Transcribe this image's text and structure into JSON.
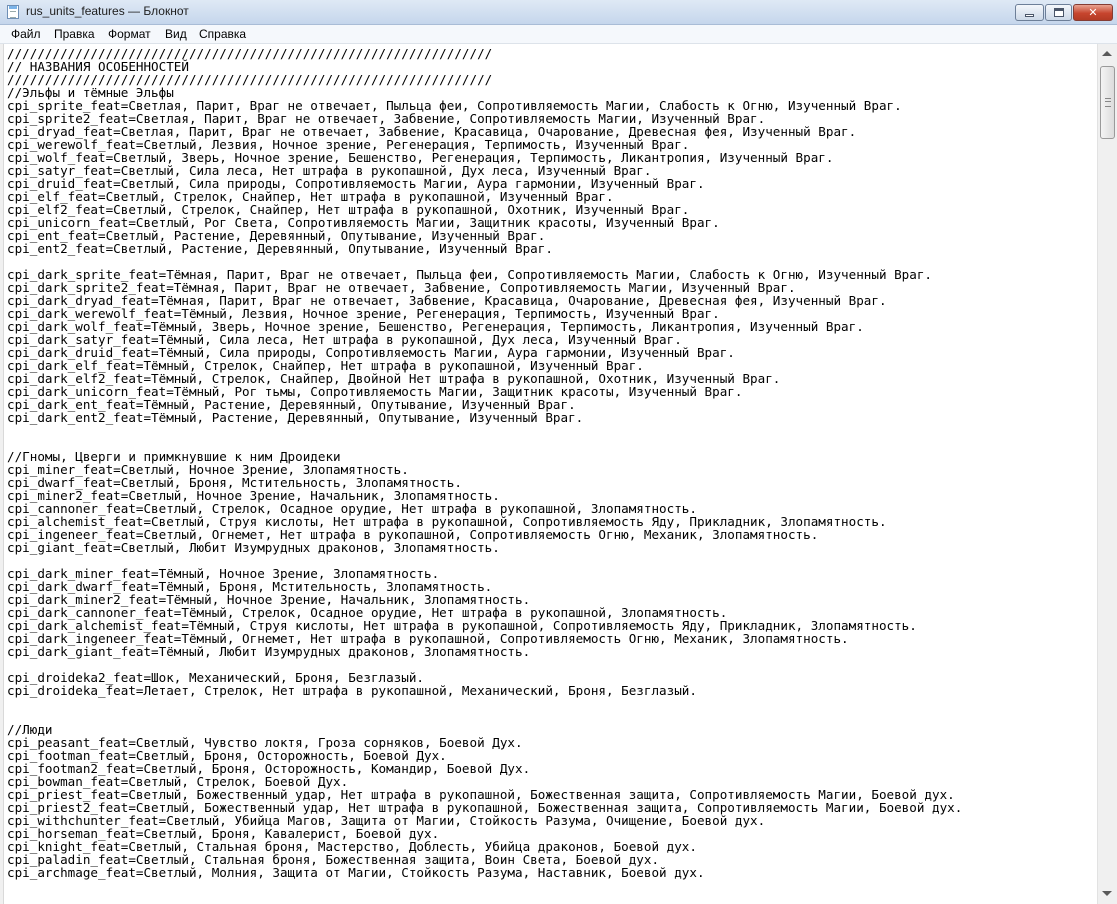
{
  "window": {
    "title": "rus_units_features — Блокнот",
    "buttons": {
      "close_glyph": "✕"
    }
  },
  "menubar": {
    "file": "Файл",
    "edit": "Правка",
    "format": "Формат",
    "view": "Вид",
    "help": "Справка"
  },
  "editor": {
    "lines": [
      "////////////////////////////////////////////////////////////////",
      "// НАЗВАНИЯ ОСОБЕННОСТЕЙ",
      "////////////////////////////////////////////////////////////////",
      "//Эльфы и тёмные Эльфы",
      "cpi_sprite_feat=Светлая, Парит, Враг не отвечает, Пыльца феи, Сопротивляемость Магии, Слабость к Огню, Изученный Враг.",
      "cpi_sprite2_feat=Светлая, Парит, Враг не отвечает, Забвение, Сопротивляемость Магии, Изученный Враг.",
      "cpi_dryad_feat=Светлая, Парит, Враг не отвечает, Забвение, Красавица, Очарование, Древесная фея, Изученный Враг.",
      "cpi_werewolf_feat=Светлый, Лезвия, Ночное зрение, Регенерация, Терпимость, Изученный Враг.",
      "cpi_wolf_feat=Светлый, Зверь, Ночное зрение, Бешенство, Регенерация, Терпимость, Ликантропия, Изученный Враг.",
      "cpi_satyr_feat=Светлый, Сила леса, Нет штрафа в рукопашной, Дух леса, Изученный Враг.",
      "cpi_druid_feat=Светлый, Сила природы, Сопротивляемость Магии, Аура гармонии, Изученный Враг.",
      "cpi_elf_feat=Светлый, Стрелок, Снайпер, Нет штрафа в рукопашной, Изученный Враг.",
      "cpi_elf2_feat=Светлый, Стрелок, Снайпер, Нет штрафа в рукопашной, Охотник, Изученный Враг.",
      "cpi_unicorn_feat=Светлый, Рог Света, Сопротивляемость Магии, Защитник красоты, Изученный Враг.",
      "cpi_ent_feat=Светлый, Растение, Деревянный, Опутывание, Изученный Враг.",
      "cpi_ent2_feat=Светлый, Растение, Деревянный, Опутывание, Изученный Враг.",
      "",
      "cpi_dark_sprite_feat=Тёмная, Парит, Враг не отвечает, Пыльца феи, Сопротивляемость Магии, Слабость к Огню, Изученный Враг.",
      "cpi_dark_sprite2_feat=Тёмная, Парит, Враг не отвечает, Забвение, Сопротивляемость Магии, Изученный Враг.",
      "cpi_dark_dryad_feat=Тёмная, Парит, Враг не отвечает, Забвение, Красавица, Очарование, Древесная фея, Изученный Враг.",
      "cpi_dark_werewolf_feat=Тёмный, Лезвия, Ночное зрение, Регенерация, Терпимость, Изученный Враг.",
      "cpi_dark_wolf_feat=Тёмный, Зверь, Ночное зрение, Бешенство, Регенерация, Терпимость, Ликантропия, Изученный Враг.",
      "cpi_dark_satyr_feat=Тёмный, Сила леса, Нет штрафа в рукопашной, Дух леса, Изученный Враг.",
      "cpi_dark_druid_feat=Тёмный, Сила природы, Сопротивляемость Магии, Аура гармонии, Изученный Враг.",
      "cpi_dark_elf_feat=Тёмный, Стрелок, Снайпер, Нет штрафа в рукопашной, Изученный Враг.",
      "cpi_dark_elf2_feat=Тёмный, Стрелок, Снайпер, Двойной Нет штрафа в рукопашной, Охотник, Изученный Враг.",
      "cpi_dark_unicorn_feat=Тёмный, Рог тьмы, Сопротивляемость Магии, Защитник красоты, Изученный Враг.",
      "cpi_dark_ent_feat=Тёмный, Растение, Деревянный, Опутывание, Изученный Враг.",
      "cpi_dark_ent2_feat=Тёмный, Растение, Деревянный, Опутывание, Изученный Враг.",
      "",
      "",
      "//Гномы, Цверги и примкнувшие к ним Дроидеки",
      "cpi_miner_feat=Светлый, Ночное Зрение, Злопамятность.",
      "cpi_dwarf_feat=Светлый, Броня, Мстительность, Злопамятность.",
      "cpi_miner2_feat=Светлый, Ночное Зрение, Начальник, Злопамятность.",
      "cpi_cannoner_feat=Светлый, Стрелок, Осадное орудие, Нет штрафа в рукопашной, Злопамятность.",
      "cpi_alchemist_feat=Светлый, Струя кислоты, Нет штрафа в рукопашной, Сопротивляемость Яду, Прикладник, Злопамятность.",
      "cpi_ingeneer_feat=Светлый, Огнемет, Нет штрафа в рукопашной, Сопротивляемость Огню, Механик, Злопамятность.",
      "cpi_giant_feat=Светлый, Любит Изумрудных драконов, Злопамятность.",
      "",
      "cpi_dark_miner_feat=Тёмный, Ночное Зрение, Злопамятность.",
      "cpi_dark_dwarf_feat=Тёмный, Броня, Мстительность, Злопамятность.",
      "cpi_dark_miner2_feat=Тёмный, Ночное Зрение, Начальник, Злопамятность.",
      "cpi_dark_cannoner_feat=Тёмный, Стрелок, Осадное орудие, Нет штрафа в рукопашной, Злопамятность.",
      "cpi_dark_alchemist_feat=Тёмный, Струя кислоты, Нет штрафа в рукопашной, Сопротивляемость Яду, Прикладник, Злопамятность.",
      "cpi_dark_ingeneer_feat=Тёмный, Огнемет, Нет штрафа в рукопашной, Сопротивляемость Огню, Механик, Злопамятность.",
      "cpi_dark_giant_feat=Тёмный, Любит Изумрудных драконов, Злопамятность.",
      "",
      "cpi_droideka2_feat=Шок, Механический, Броня, Безглазый.",
      "cpi_droideka_feat=Летает, Стрелок, Нет штрафа в рукопашной, Механический, Броня, Безглазый.",
      "",
      "",
      "//Люди",
      "cpi_peasant_feat=Светлый, Чувство локтя, Гроза сорняков, Боевой Дух.",
      "cpi_footman_feat=Светлый, Броня, Осторожность, Боевой Дух.",
      "cpi_footman2_feat=Светлый, Броня, Осторожность, Командир, Боевой Дух.",
      "cpi_bowman_feat=Светлый, Стрелок, Боевой Дух.",
      "cpi_priest_feat=Светлый, Божественный удар, Нет штрафа в рукопашной, Божественная защита, Сопротивляемость Магии, Боевой дух.",
      "cpi_priest2_feat=Светлый, Божественный удар, Нет штрафа в рукопашной, Божественная защита, Сопротивляемость Магии, Боевой дух.",
      "cpi_withchunter_feat=Светлый, Убийца Магов, Защита от Магии, Стойкость Разума, Очищение, Боевой дух.",
      "cpi_horseman_feat=Светлый, Броня, Кавалерист, Боевой дух.",
      "cpi_knight_feat=Светлый, Стальная броня, Мастерство, Доблесть, Убийца драконов, Боевой дух.",
      "cpi_paladin_feat=Светлый, Стальная броня, Божественная защита, Воин Света, Боевой дух.",
      "cpi_archmage_feat=Светлый, Молния, Защита от Магии, Стойкость Разума, Наставник, Боевой дух."
    ]
  }
}
